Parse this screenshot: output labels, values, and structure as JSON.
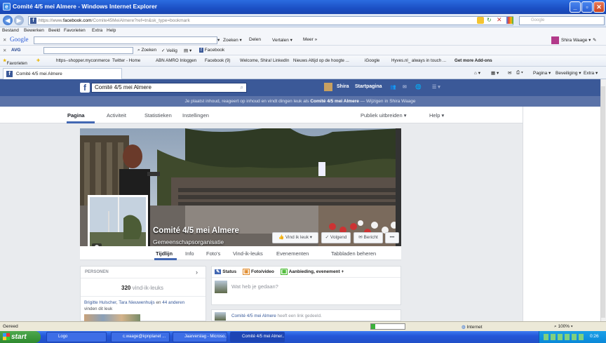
{
  "window": {
    "title": "Comité 4/5 mei Almere - Windows Internet Explorer",
    "app_icon": "ie-icon"
  },
  "address": {
    "url_scheme": "https://www.",
    "url_domain": "facebook.com",
    "url_path": "/Comite45MeiAlmere?ref=tn&sk_type=bookmark",
    "search_placeholder": "Google"
  },
  "menu": [
    "Bestand",
    "Bewerken",
    "Beeld",
    "Favorieten",
    "Extra",
    "Help"
  ],
  "google_toolbar": {
    "label": "Google",
    "zoeken": "Zoeken",
    "meer": "Delen",
    "vertalen": "Vertalen",
    "meer2": "Meer",
    "user": "Shira Waage"
  },
  "avg_toolbar": {
    "label": "AVG",
    "zoeken": "Zoeken",
    "veilig": "Veilig",
    "facebook": "Facebook"
  },
  "favorites": {
    "label": "Favorieten",
    "items": [
      "https--shopper.myconmerce",
      "Twitter - Home",
      "ABN AMRO Inloggen",
      "Facebook (9)",
      "Welcome, Shira! LinkedIn",
      "Nieuws  Altijd op de hoogte ...",
      "iGoogle",
      "Hyves.nl_ always in touch ...",
      "Get more Add-ons"
    ]
  },
  "tab": {
    "title": "Comité 4/5 mei Almere"
  },
  "command_bar": [
    "Pagina",
    "Beveiliging",
    "Extra"
  ],
  "facebook": {
    "search_value": "Comité 4/5 mei Almere",
    "user_name": "Shira",
    "home": "Startpagina",
    "notice_pre": "Je plaatst inhoud, reageert op inhoud en vindt dingen leuk als",
    "notice_page": "Comité 4/5 mei Almere",
    "notice_post": " — Wijzigen in Shira Waage",
    "admin_tabs": [
      "Pagina",
      "Activiteit",
      "Statistieken",
      "Instellingen"
    ],
    "admin_right": [
      "Publiek uitbreiden ▾",
      "Help ▾"
    ],
    "page_name": "Comité 4/5 mei Almere",
    "page_category": "Gemeenschapsorganisatie",
    "buttons": {
      "like": "Vind ik leuk",
      "following": "Volgend",
      "message": "Bericht",
      "more": "•••"
    },
    "timeline_tabs": [
      "Tijdlijn",
      "Info",
      "Foto's",
      "Vind-ik-leuks",
      "Evenementen",
      "Tabbladen beheren"
    ],
    "people": {
      "header": "PERSONEN",
      "count": "320",
      "count_label": "vind-ik-leuks",
      "friends_a": "Brigitte Hulscher",
      "friends_b": "Tara Nieuwenhuijs",
      "friends_c": "44 anderen",
      "friends_tail": "vinden dit leuk"
    },
    "composer": {
      "status": "Status",
      "photo": "Foto/video",
      "offer": "Aanbieding, evenement +",
      "placeholder": "Wat heb je gedaan?"
    },
    "post_preview": {
      "author": "Comité 4/5 mei Almere",
      "text": "heeft een link gedeeld."
    }
  },
  "statusbar": {
    "left": "Gereed",
    "zone": "Internet",
    "zoom": "100%"
  },
  "taskbar": {
    "start": "start",
    "tasks": [
      "Logo",
      "c.waage@kpnplanet ...",
      "Jaarverslag - Microso...",
      "Comité 4/5 mei Almer..."
    ],
    "clock": "0:26"
  },
  "colors": {
    "facebook_blue": "#3b5998",
    "xp_blue": "#2456d8",
    "start_green": "#2e8a2e"
  }
}
